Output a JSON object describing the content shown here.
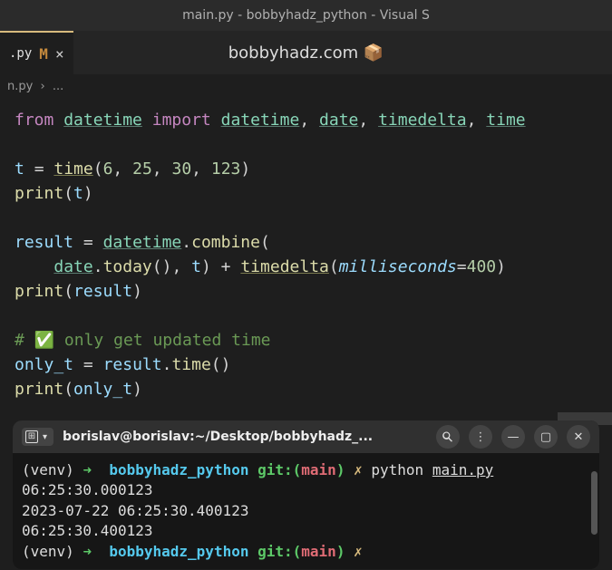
{
  "titlebar": "main.py - bobbyhadz_python - Visual S",
  "tab": {
    "filename": ".py",
    "modified": "M",
    "close": "×"
  },
  "watermark": "bobbyhadz.com 📦",
  "breadcrumb": {
    "file": "n.py",
    "sep": "›",
    "rest": "..."
  },
  "code": {
    "l1": {
      "from": "from",
      "m1": "datetime",
      "import": "import",
      "m2": "datetime",
      "m3": "date",
      "m4": "timedelta",
      "m5": "time"
    },
    "l3": {
      "v": "t",
      "eq": "=",
      "fn": "time",
      "n1": "6",
      "n2": "25",
      "n3": "30",
      "n4": "123"
    },
    "l4": {
      "fn": "print",
      "arg": "t"
    },
    "l6": {
      "v": "result",
      "eq": "=",
      "m": "datetime",
      "fn": "combine"
    },
    "l7": {
      "indent": "    ",
      "m": "date",
      "fn": "today",
      "v2": "t",
      "plus": "+",
      "td": "timedelta",
      "param": "milliseconds",
      "val": "400"
    },
    "l8": {
      "fn": "print",
      "arg": "result"
    },
    "l10": {
      "text": "# ✅ only get updated time"
    },
    "l11": {
      "v": "only_t",
      "eq": "=",
      "arg": "result",
      "fn": "time"
    },
    "l12": {
      "fn": "print",
      "arg": "only_t"
    }
  },
  "terminal": {
    "title": "borislav@borislav:~/Desktop/bobbyhadz_...",
    "actions": {
      "menu": "⋮",
      "min": "—",
      "max": "▢",
      "close": "✕"
    },
    "lines": [
      {
        "type": "prompt",
        "venv": "(venv)",
        "arrow": "➜",
        "dir": "bobbyhadz_python",
        "git": "git:",
        "branch": "main",
        "x": "✗",
        "cmd": "python",
        "file": "main.py"
      },
      {
        "type": "out",
        "text": "06:25:30.000123"
      },
      {
        "type": "out",
        "text": "2023-07-22 06:25:30.400123"
      },
      {
        "type": "out",
        "text": "06:25:30.400123"
      },
      {
        "type": "prompt",
        "venv": "(venv)",
        "arrow": "➜",
        "dir": "bobbyhadz_python",
        "git": "git:",
        "branch": "main",
        "x": "✗",
        "cmd": "",
        "file": ""
      }
    ]
  }
}
